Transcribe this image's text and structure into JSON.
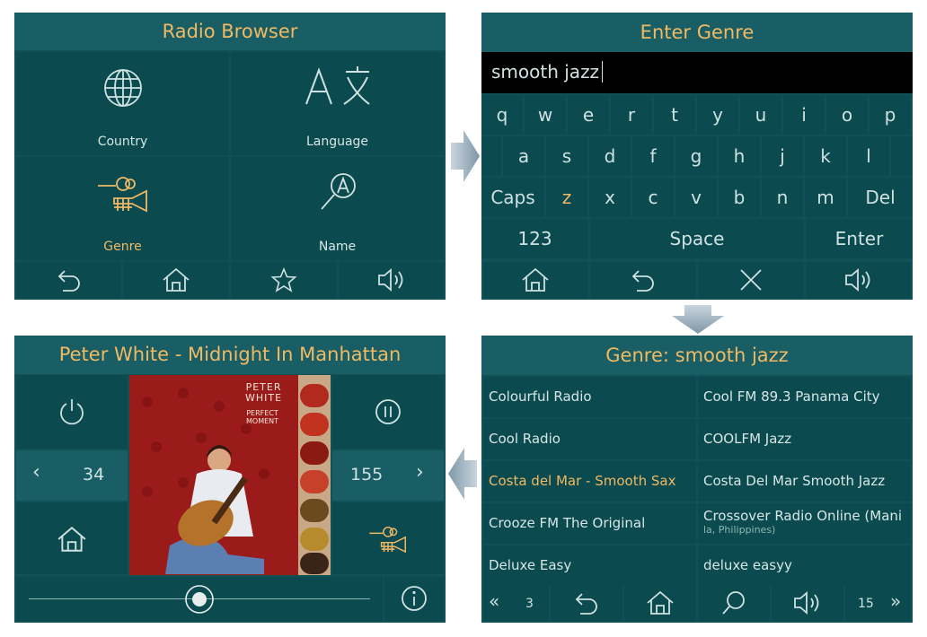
{
  "radio_browser": {
    "title": "Radio Browser",
    "tiles": [
      {
        "label": "Country",
        "icon": "globe-icon"
      },
      {
        "label": "Language",
        "icon": "language-icon"
      },
      {
        "label": "Genre",
        "icon": "instruments-icon"
      },
      {
        "label": "Name",
        "icon": "search-name-icon"
      }
    ],
    "nav": [
      "back-icon",
      "home-icon",
      "star-icon",
      "speaker-icon"
    ]
  },
  "enter_genre": {
    "title": "Enter Genre",
    "input_value": "smooth jazz",
    "rows": [
      [
        "q",
        "w",
        "e",
        "r",
        "t",
        "y",
        "u",
        "i",
        "o",
        "p"
      ],
      [
        "a",
        "s",
        "d",
        "f",
        "g",
        "h",
        "j",
        "k",
        "l"
      ],
      [
        "Caps",
        "z",
        "x",
        "c",
        "v",
        "b",
        "n",
        "m",
        "Del"
      ],
      [
        "123",
        "Space",
        "Enter"
      ]
    ],
    "nav": [
      "home-icon",
      "back-icon",
      "close-icon",
      "speaker-icon"
    ]
  },
  "genre_list": {
    "title": "Genre: smooth jazz",
    "items": [
      {
        "name": "Colourful Radio"
      },
      {
        "name": "Cool FM 89.3 Panama City"
      },
      {
        "name": "Cool Radio"
      },
      {
        "name": "COOLFM Jazz"
      },
      {
        "name": "Costa del Mar - Smooth Sax"
      },
      {
        "name": "Costa Del Mar Smooth Jazz"
      },
      {
        "name": "Crooze FM The Original"
      },
      {
        "name": "Crossover Radio Online (Mani",
        "sub": "la, Philippines)"
      },
      {
        "name": "Deluxe Easy"
      },
      {
        "name": "deluxe easyy"
      }
    ],
    "page_left": "3",
    "page_right": "15"
  },
  "player": {
    "title": "Peter White - Midnight In Manhattan",
    "prev_value": "34",
    "next_value": "155",
    "album_art_text": {
      "artist": "PETER\nWHITE",
      "album": "PERFECT\nMOMENT"
    },
    "volume_level": 0.5
  },
  "colors": {
    "panel": "#0f5157",
    "cell": "#0b4a4f",
    "accent": "#f0b964",
    "arrow": "#8fa6b5"
  }
}
